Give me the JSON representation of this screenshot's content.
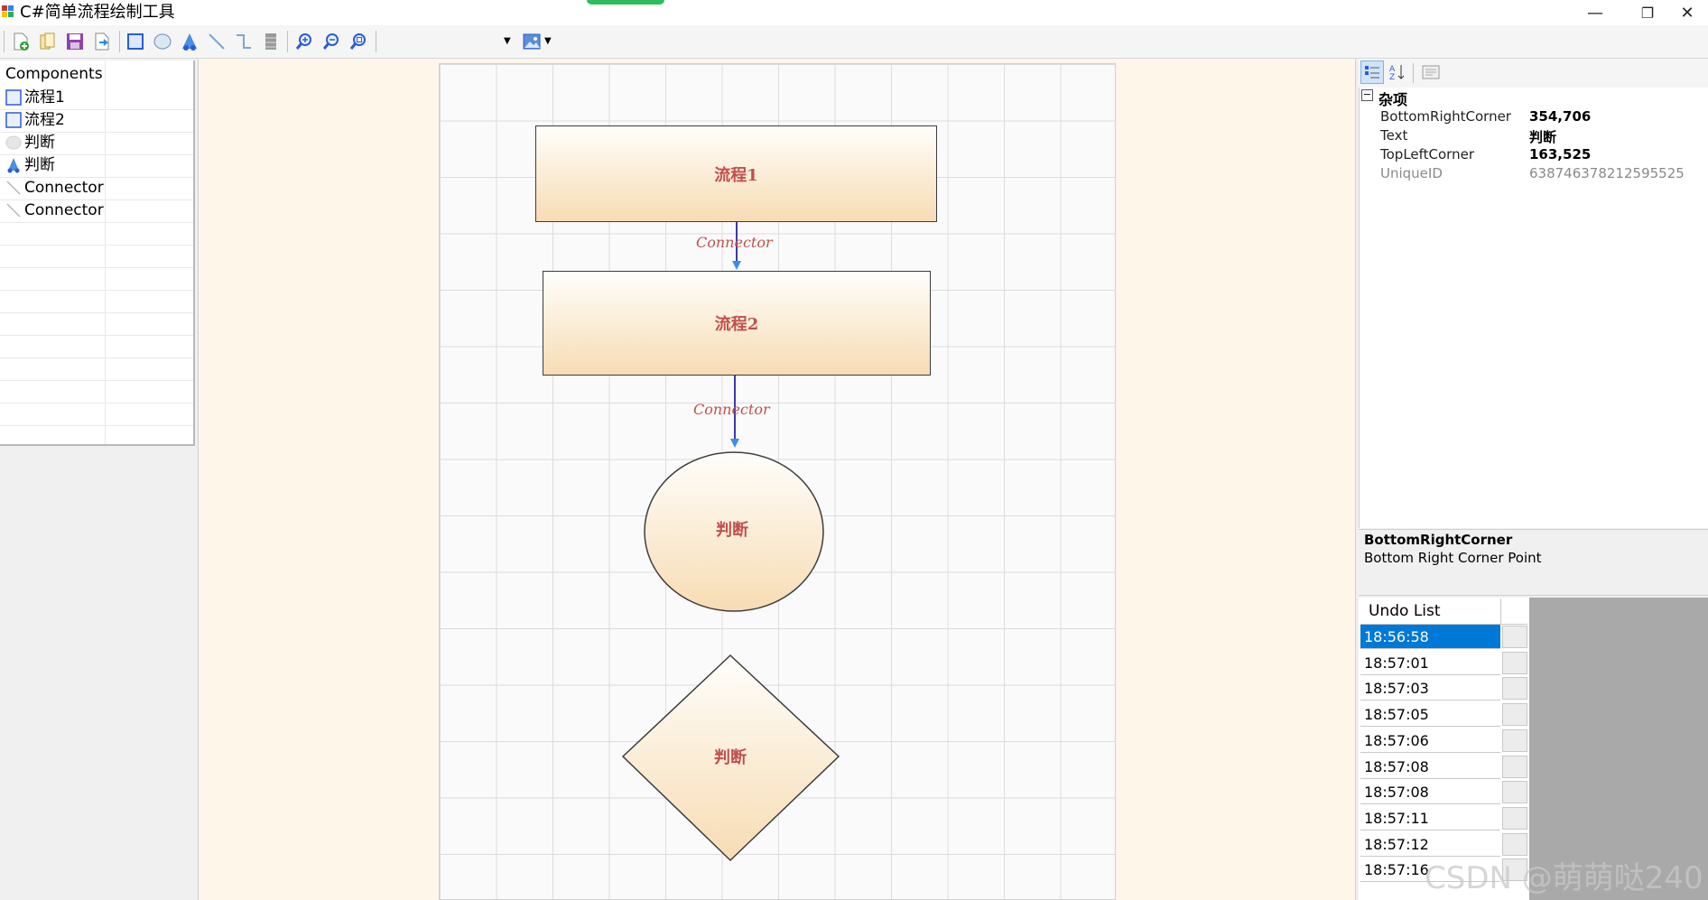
{
  "app": {
    "title": "C#简单流程绘制工具"
  },
  "window_controls": {
    "minimize": "—",
    "restore": "❐",
    "close": "✕"
  },
  "toolbar": {
    "icons": [
      "new-file-icon",
      "open-file-icon",
      "save-icon",
      "export-icon",
      "rectangle-tool-icon",
      "ellipse-tool-icon",
      "diamond-tool-icon",
      "line-tool-icon",
      "connector-tool-icon",
      "layer-icon",
      "zoom-in-icon",
      "zoom-out-icon",
      "zoom-fit-icon",
      "image-icon"
    ]
  },
  "components": {
    "header": "Components",
    "items": [
      {
        "icon": "rectangle-icon",
        "label": "流程1"
      },
      {
        "icon": "rectangle-icon",
        "label": "流程2"
      },
      {
        "icon": "ellipse-icon",
        "label": "判断"
      },
      {
        "icon": "diamond-icon",
        "label": "判断"
      },
      {
        "icon": "line-icon",
        "label": "Connector"
      },
      {
        "icon": "line-icon",
        "label": "Connector"
      }
    ]
  },
  "canvas": {
    "process1": "流程1",
    "process2": "流程2",
    "ellipse": "判断",
    "diamond": "判断",
    "connector1": "Connector",
    "connector2": "Connector"
  },
  "properties": {
    "category": "杂项",
    "rows": [
      {
        "name": "BottomRightCorner",
        "value": "354,706"
      },
      {
        "name": "Text",
        "value": "判断"
      },
      {
        "name": "TopLeftCorner",
        "value": "163,525"
      },
      {
        "name": "UniqueID",
        "value": "638746378212595525"
      }
    ],
    "help_title": "BottomRightCorner",
    "help_text": "Bottom Right Corner Point"
  },
  "undo": {
    "header": "Undo List",
    "selected_index": 0,
    "items": [
      "18:56:58",
      "18:57:01",
      "18:57:03",
      "18:57:05",
      "18:57:06",
      "18:57:08",
      "18:57:08",
      "18:57:11",
      "18:57:12",
      "18:57:16"
    ]
  },
  "watermark": "CSDN @萌萌哒240",
  "colors": {
    "selection": "#0078d7",
    "shape_text": "#c0504d",
    "connector": "#3a3aa8",
    "arrow": "#3b8fe6"
  }
}
